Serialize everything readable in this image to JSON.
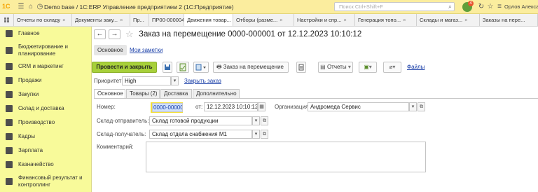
{
  "titlebar": {
    "logo": "1С",
    "title": "Demo base / 1С:ERP Управление предприятием 2  (1С:Предприятие)",
    "search_placeholder": "Поиск Ctrl+Shift+F",
    "notification_count": "4",
    "user": "Орлов Александр"
  },
  "tabs": [
    {
      "label": "Отчеты по складу"
    },
    {
      "label": "Документы заку..."
    },
    {
      "label": "Пр..."
    },
    {
      "label": "ПР00-000004"
    },
    {
      "label": "Движения товар..."
    },
    {
      "label": "Отборы (разме..."
    },
    {
      "label": "Настройки и спр..."
    },
    {
      "label": "Генерация топо..."
    },
    {
      "label": "Склады и магаз..."
    },
    {
      "label": "Заказы на пере..."
    }
  ],
  "sidebar": {
    "items": [
      {
        "label": "Главное"
      },
      {
        "label": "Бюджетирование и"
      },
      {
        "label": "планирование"
      },
      {
        "label": "CRM и маркетинг"
      },
      {
        "label": "Продажи"
      },
      {
        "label": "Закупки"
      },
      {
        "label": "Склад и доставка"
      },
      {
        "label": "Производство"
      },
      {
        "label": "Кадры"
      },
      {
        "label": "Зарплата"
      },
      {
        "label": "Казначейство"
      },
      {
        "label": "Финансовый результат и"
      },
      {
        "label": "контроллинг"
      }
    ]
  },
  "doc": {
    "title": "Заказ на перемещение 0000-000001 от 12.12.2023 10:10:12",
    "subtab_main": "Основное",
    "subtab_notes": "Мои заметки"
  },
  "toolbar": {
    "post_close": "Провести и закрыть",
    "order_print": "Заказ на перемещение",
    "reports": "Отчеты",
    "files": "Файлы"
  },
  "form": {
    "priority_label": "Приоритет:",
    "priority_value": "High",
    "close_order": "Закрыть заказ",
    "tabs": [
      "Основное",
      "Товары (2)",
      "Доставка",
      "Дополнительно"
    ],
    "number_label": "Номер:",
    "number_value": "0000-000001",
    "date_label": "от:",
    "date_value": "12.12.2023 10:10:12",
    "org_label": "Организация:",
    "org_value": "Андромеда Сервис",
    "sender_label": "Склад-отправитель:",
    "sender_value": "Склад готовой продукции",
    "receiver_label": "Склад-получатель:",
    "receiver_value": "Склад отдела снабжения М1",
    "comment_label": "Комментарий:"
  }
}
